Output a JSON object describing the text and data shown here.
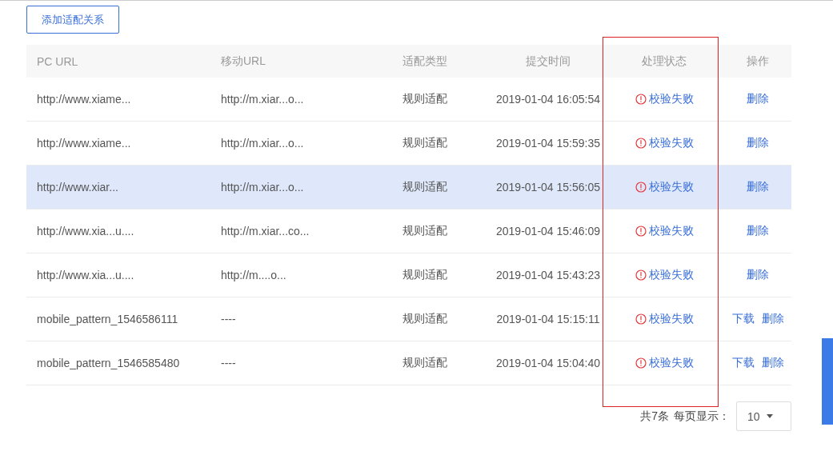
{
  "add_button": "添加适配关系",
  "table": {
    "columns": [
      "PC URL",
      "移动URL",
      "适配类型",
      "提交时间",
      "处理状态",
      "操作"
    ],
    "rows": [
      {
        "pc_url": "http://www.xiame...",
        "mobile_url": "http://m.xiar...o...",
        "type": "规则适配",
        "time": "2019-01-04 16:05:54",
        "status": {
          "kind": "error",
          "text": "校验失败"
        },
        "actions": [
          "删除"
        ],
        "selected": false
      },
      {
        "pc_url": "http://www.xiame...",
        "mobile_url": "http://m.xiar...o...",
        "type": "规则适配",
        "time": "2019-01-04 15:59:35",
        "status": {
          "kind": "error",
          "text": "校验失败"
        },
        "actions": [
          "删除"
        ],
        "selected": false
      },
      {
        "pc_url": "http://www.xiar...",
        "mobile_url": "http://m.xiar...o...",
        "type": "规则适配",
        "time": "2019-01-04 15:56:05",
        "status": {
          "kind": "error",
          "text": "校验失败"
        },
        "actions": [
          "删除"
        ],
        "selected": true
      },
      {
        "pc_url": "http://www.xia...u....",
        "mobile_url": "http://m.xiar...co...",
        "type": "规则适配",
        "time": "2019-01-04 15:46:09",
        "status": {
          "kind": "error",
          "text": "校验失败"
        },
        "actions": [
          "删除"
        ],
        "selected": false
      },
      {
        "pc_url": "http://www.xia...u....",
        "mobile_url": "http://m....o...",
        "type": "规则适配",
        "time": "2019-01-04 15:43:23",
        "status": {
          "kind": "error",
          "text": "校验失败"
        },
        "actions": [
          "删除"
        ],
        "selected": false
      },
      {
        "pc_url": "mobile_pattern_1546586111",
        "mobile_url": "----",
        "type": "规则适配",
        "time": "2019-01-04 15:15:11",
        "status": {
          "kind": "error",
          "text": "校验失败"
        },
        "actions": [
          "下载",
          "删除"
        ],
        "selected": false
      },
      {
        "pc_url": "mobile_pattern_1546585480",
        "mobile_url": "----",
        "type": "规则适配",
        "time": "2019-01-04 15:04:40",
        "status": {
          "kind": "error",
          "text": "校验失败"
        },
        "actions": [
          "下载",
          "删除"
        ],
        "selected": false
      }
    ]
  },
  "pagination": {
    "total": "共7条",
    "page_size_label": "每页显示：",
    "page_size": "10"
  }
}
